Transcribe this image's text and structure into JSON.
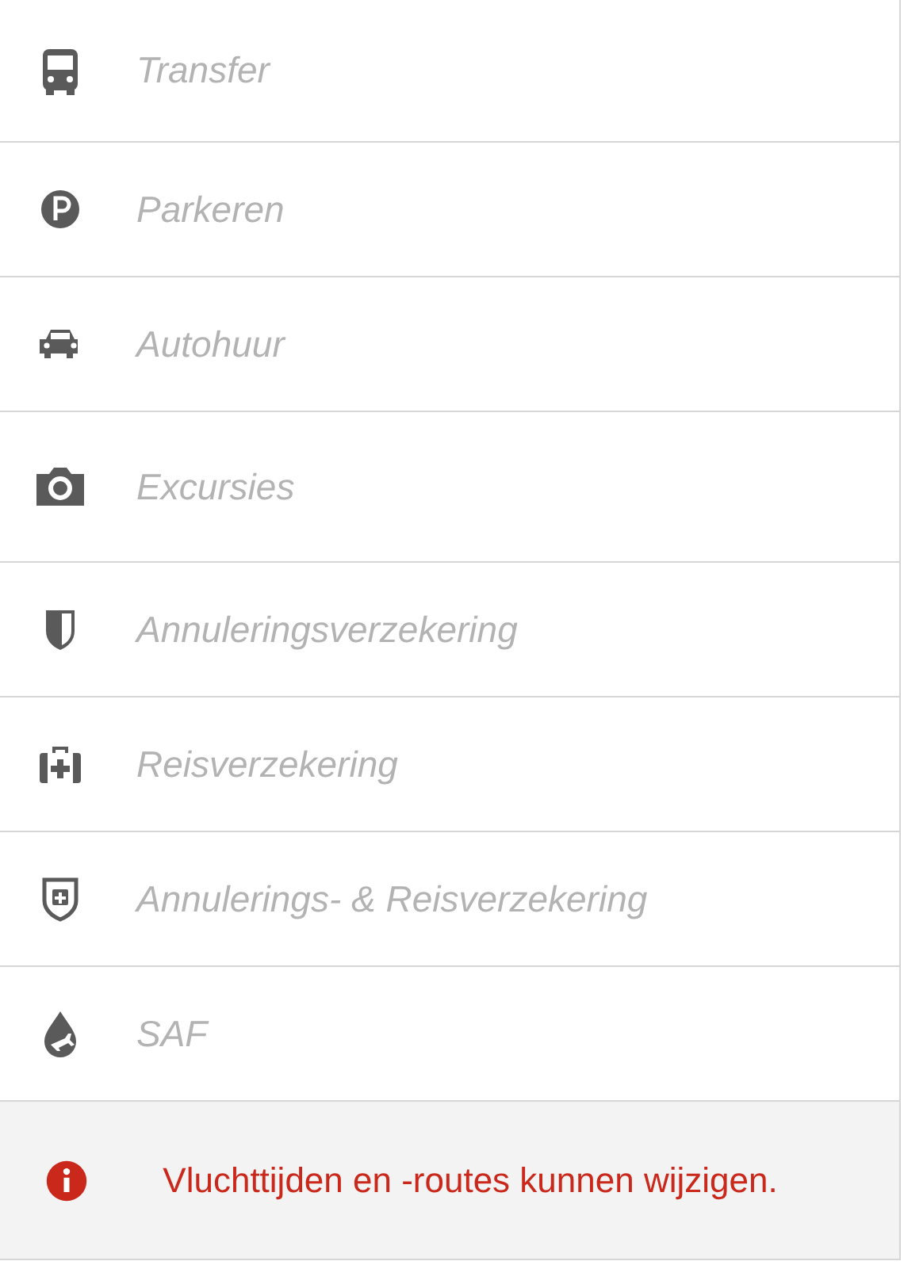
{
  "options": [
    {
      "label": "Transfer"
    },
    {
      "label": "Parkeren"
    },
    {
      "label": "Autohuur"
    },
    {
      "label": "Excursies"
    },
    {
      "label": "Annuleringsverzekering"
    },
    {
      "label": "Reisverzekering"
    },
    {
      "label": "Annulerings- & Reisverzekering"
    },
    {
      "label": "SAF"
    }
  ],
  "notice": {
    "text": "Vluchttijden en -routes kunnen wijzigen."
  }
}
